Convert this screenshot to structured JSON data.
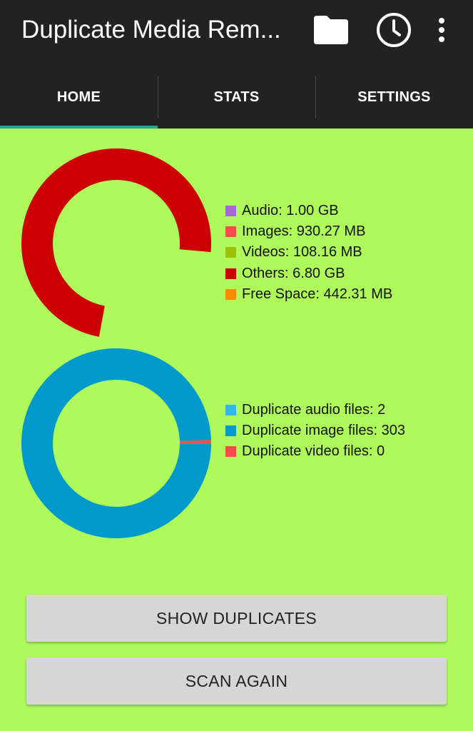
{
  "app": {
    "title": "Duplicate Media Rem..."
  },
  "toolbar": {
    "icons": [
      "folder-icon",
      "history-clock-icon",
      "more-vert-icon"
    ]
  },
  "tabs": [
    {
      "label": "HOME",
      "active": true
    },
    {
      "label": "STATS",
      "active": false
    },
    {
      "label": "SETTINGS",
      "active": false
    }
  ],
  "colors": {
    "background": "#ADFA5A",
    "appbar": "#222222",
    "tab_indicator": "#26A69A",
    "audio": "#A868D0",
    "images": "#FF4B4B",
    "videos": "#9CC10A",
    "others": "#CC0000",
    "free_space": "#FF8C00",
    "dup_audio": "#33B7E6",
    "dup_image": "#0099CC",
    "dup_video": "#FF4B4B"
  },
  "storage_legend": [
    {
      "label": "Audio: 1.00 GB",
      "color": "#A868D0"
    },
    {
      "label": "Images: 930.27 MB",
      "color": "#FF4B4B"
    },
    {
      "label": "Videos: 108.16 MB",
      "color": "#9CC10A"
    },
    {
      "label": "Others: 6.80 GB",
      "color": "#CC0000"
    },
    {
      "label": "Free Space: 442.31 MB",
      "color": "#FF8C00"
    }
  ],
  "duplicates_legend": [
    {
      "label": "Duplicate audio files: 2",
      "color": "#33B7E6"
    },
    {
      "label": "Duplicate image files: 303",
      "color": "#0099CC"
    },
    {
      "label": "Duplicate video files: 0",
      "color": "#FF4B4B"
    }
  ],
  "chart_data": [
    {
      "type": "pie",
      "donut": true,
      "categories": [
        "Audio",
        "Images",
        "Videos",
        "Others",
        "Free Space"
      ],
      "values_mb": [
        1024,
        930.27,
        108.16,
        6963.2,
        442.31
      ],
      "colors": [
        "#A868D0",
        "#FF4B4B",
        "#9CC10A",
        "#CC0000",
        "#FF8C00"
      ]
    },
    {
      "type": "pie",
      "donut": true,
      "categories": [
        "Duplicate audio files",
        "Duplicate image files",
        "Duplicate video files"
      ],
      "values": [
        2,
        303,
        0
      ],
      "colors": [
        "#FF4B4B",
        "#0099CC",
        "#33B7E6"
      ]
    }
  ],
  "buttons": {
    "show_duplicates": "SHOW DUPLICATES",
    "scan_again": "SCAN AGAIN"
  }
}
